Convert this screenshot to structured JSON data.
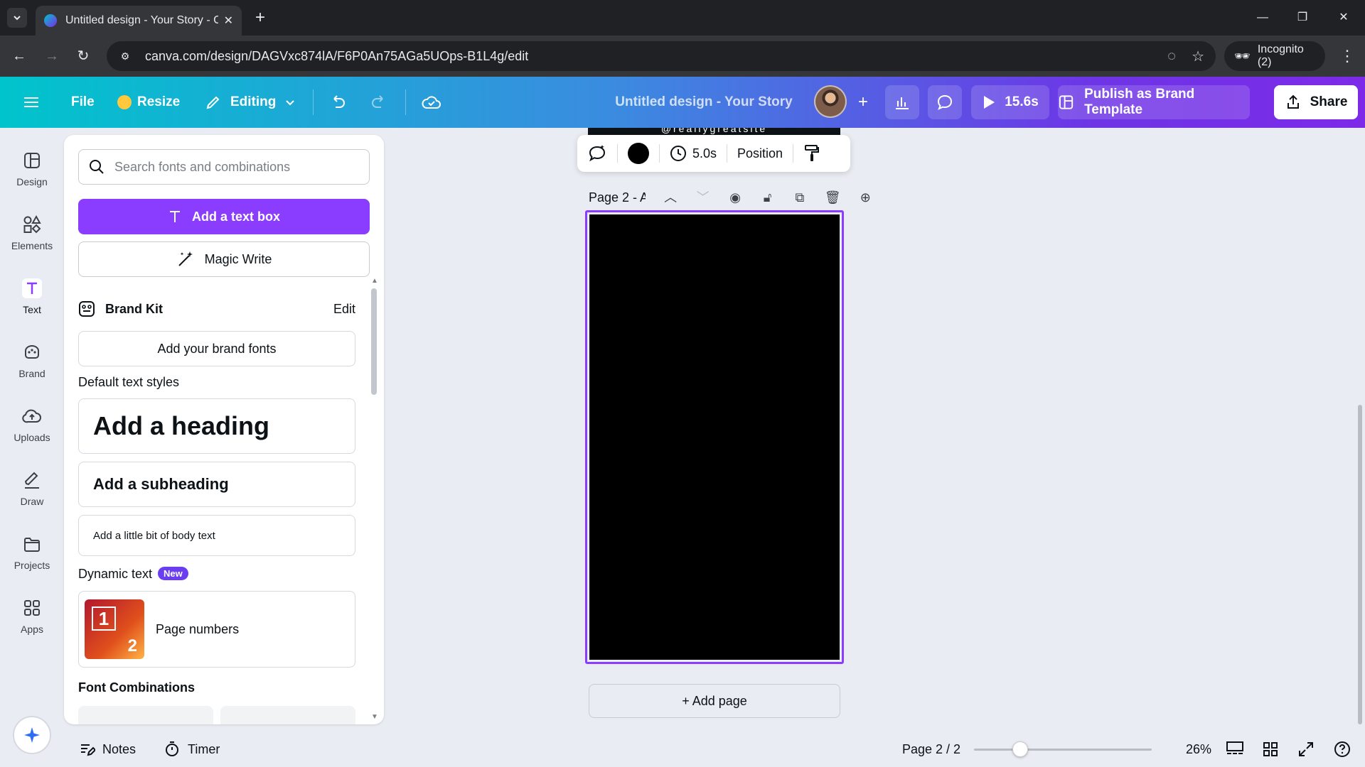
{
  "browser": {
    "tab_title": "Untitled design - Your Story - C",
    "url": "canva.com/design/DAGVxc874lA/F6P0An75AGa5UOps-B1L4g/edit",
    "incognito_label": "Incognito (2)"
  },
  "header": {
    "file_label": "File",
    "resize_label": "Resize",
    "editing_label": "Editing",
    "design_title": "Untitled design - Your Story",
    "play_duration": "15.6s",
    "publish_label": "Publish as Brand Template",
    "share_label": "Share"
  },
  "rail": {
    "items": [
      {
        "label": "Design",
        "icon": "design-icon"
      },
      {
        "label": "Elements",
        "icon": "elements-icon"
      },
      {
        "label": "Text",
        "icon": "text-icon"
      },
      {
        "label": "Brand",
        "icon": "brand-icon"
      },
      {
        "label": "Uploads",
        "icon": "uploads-icon"
      },
      {
        "label": "Draw",
        "icon": "draw-icon"
      },
      {
        "label": "Projects",
        "icon": "projects-icon"
      },
      {
        "label": "Apps",
        "icon": "apps-icon"
      }
    ]
  },
  "panel": {
    "search_placeholder": "Search fonts and combinations",
    "add_textbox_label": "Add a text box",
    "magic_write_label": "Magic Write",
    "brand_kit_label": "Brand Kit",
    "brand_kit_edit": "Edit",
    "add_brand_fonts": "Add your brand fonts",
    "default_styles_title": "Default text styles",
    "heading_label": "Add a heading",
    "subheading_label": "Add a subheading",
    "body_label": "Add a little bit of body text",
    "dynamic_text_title": "Dynamic text",
    "new_badge": "New",
    "page_numbers_label": "Page numbers",
    "thumb_num_1": "1",
    "thumb_num_2": "2",
    "font_combinations_title": "Font Combinations"
  },
  "canvas": {
    "prev_page_text": "@reallygreatsite",
    "duration": "5.0s",
    "position_label": "Position",
    "page_label": "Page 2 - A...",
    "add_page_label": "+ Add page"
  },
  "bottombar": {
    "notes_label": "Notes",
    "timer_label": "Timer",
    "page_indicator": "Page 2 / 2",
    "zoom_level": "26%",
    "zoom_fraction": 0.26
  },
  "colors": {
    "accent_purple": "#8b3dff",
    "header_gradient_start": "#00c4cc",
    "header_gradient_end": "#7d2ae8",
    "selected_fill": "#000000"
  }
}
